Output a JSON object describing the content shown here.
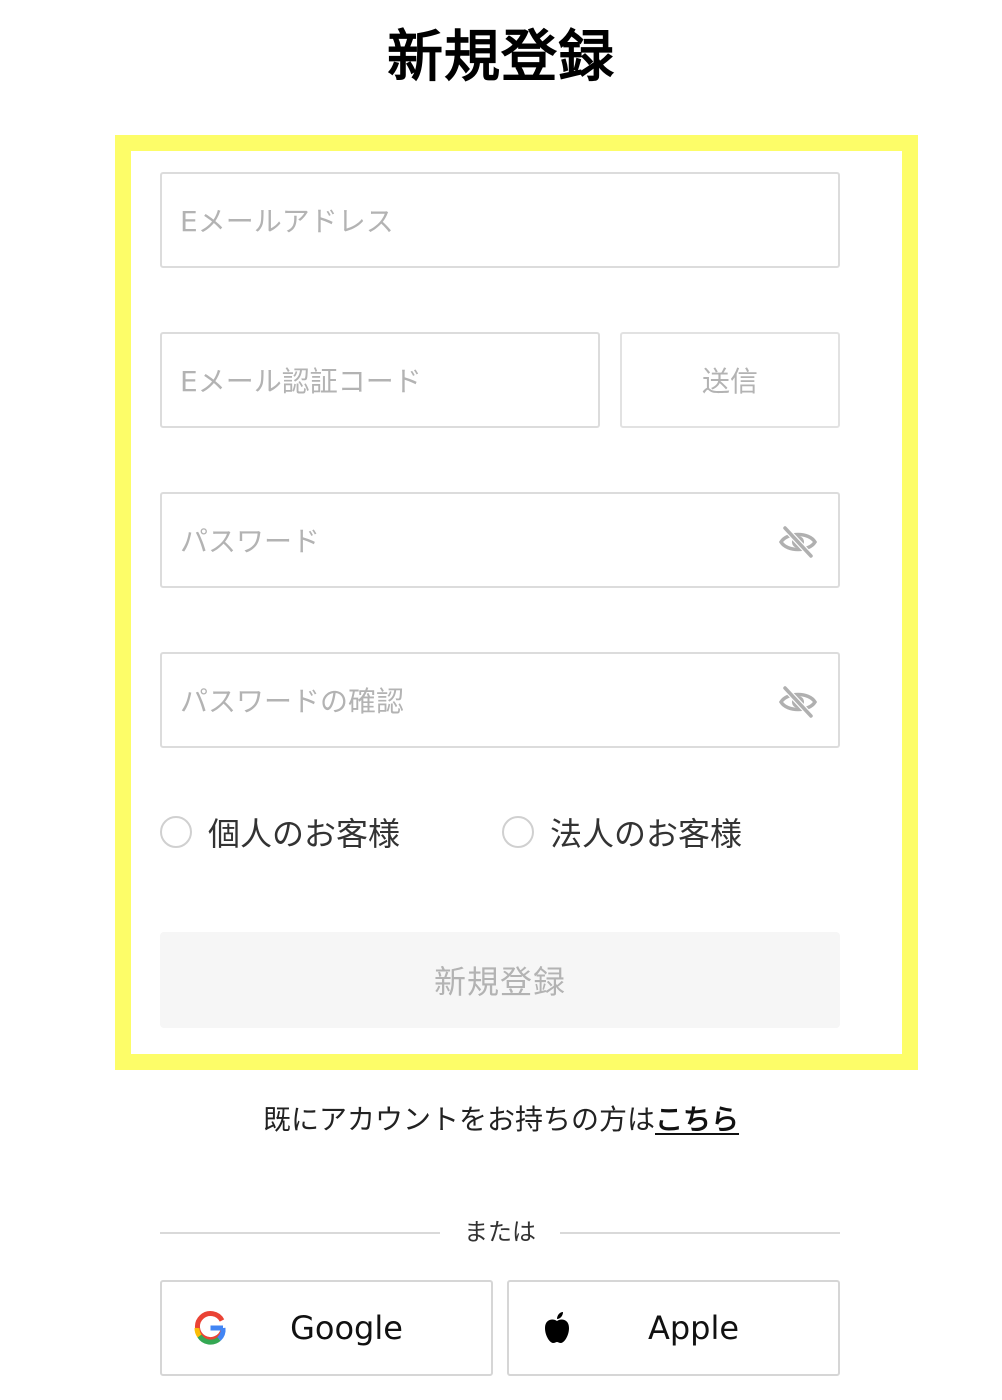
{
  "page": {
    "title": "新規登録"
  },
  "form": {
    "email_placeholder": "Eメールアドレス",
    "code_placeholder": "Eメール認証コード",
    "send_label": "送信",
    "password_placeholder": "パスワード",
    "password_confirm_placeholder": "パスワードの確認",
    "customer_type_options": [
      "個人のお客様",
      "法人のお客様"
    ],
    "submit_label": "新規登録"
  },
  "login": {
    "prompt": "既にアカウントをお持ちの方は",
    "link_label": "こちら"
  },
  "social": {
    "divider_label": "または",
    "google_label": "Google",
    "apple_label": "Apple"
  },
  "colors": {
    "highlight": "#fdfd68",
    "placeholder": "#b3b3b3",
    "disabled_button_bg": "#f6f6f6"
  },
  "icons": [
    "eye-slash-icon",
    "google-logo-icon",
    "apple-logo-icon"
  ]
}
